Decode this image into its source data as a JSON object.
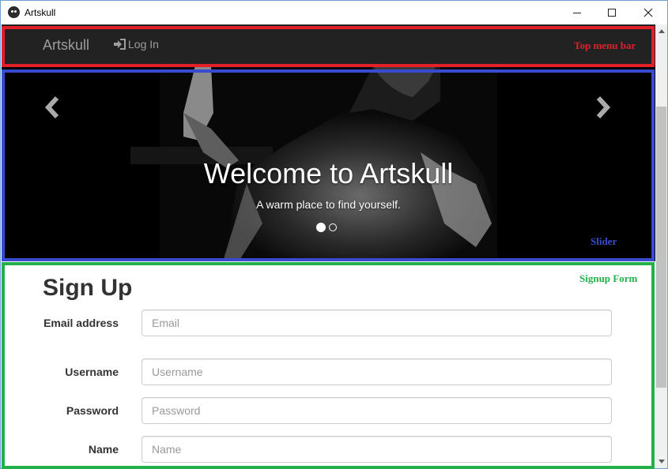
{
  "window": {
    "title": "Artskull"
  },
  "navbar": {
    "brand": "Artskull",
    "login_label": "Log In"
  },
  "carousel": {
    "title": "Welcome to Artskull",
    "subtitle": "A warm place to find yourself.",
    "slide_count": 2,
    "active_slide": 1
  },
  "form": {
    "title": "Sign Up",
    "fields": [
      {
        "label": "Email address",
        "placeholder": "Email"
      },
      {
        "label": "Username",
        "placeholder": "Username"
      },
      {
        "label": "Password",
        "placeholder": "Password"
      },
      {
        "label": "Name",
        "placeholder": "Name"
      }
    ]
  },
  "annotations": {
    "top_menu": "Top menu bar",
    "slider": "Slider",
    "signup": "Signup Form"
  },
  "colors": {
    "navbar": "#222222",
    "annotation_red": "#e0202a",
    "annotation_blue": "#3a4bd0",
    "annotation_green": "#21b04a"
  }
}
